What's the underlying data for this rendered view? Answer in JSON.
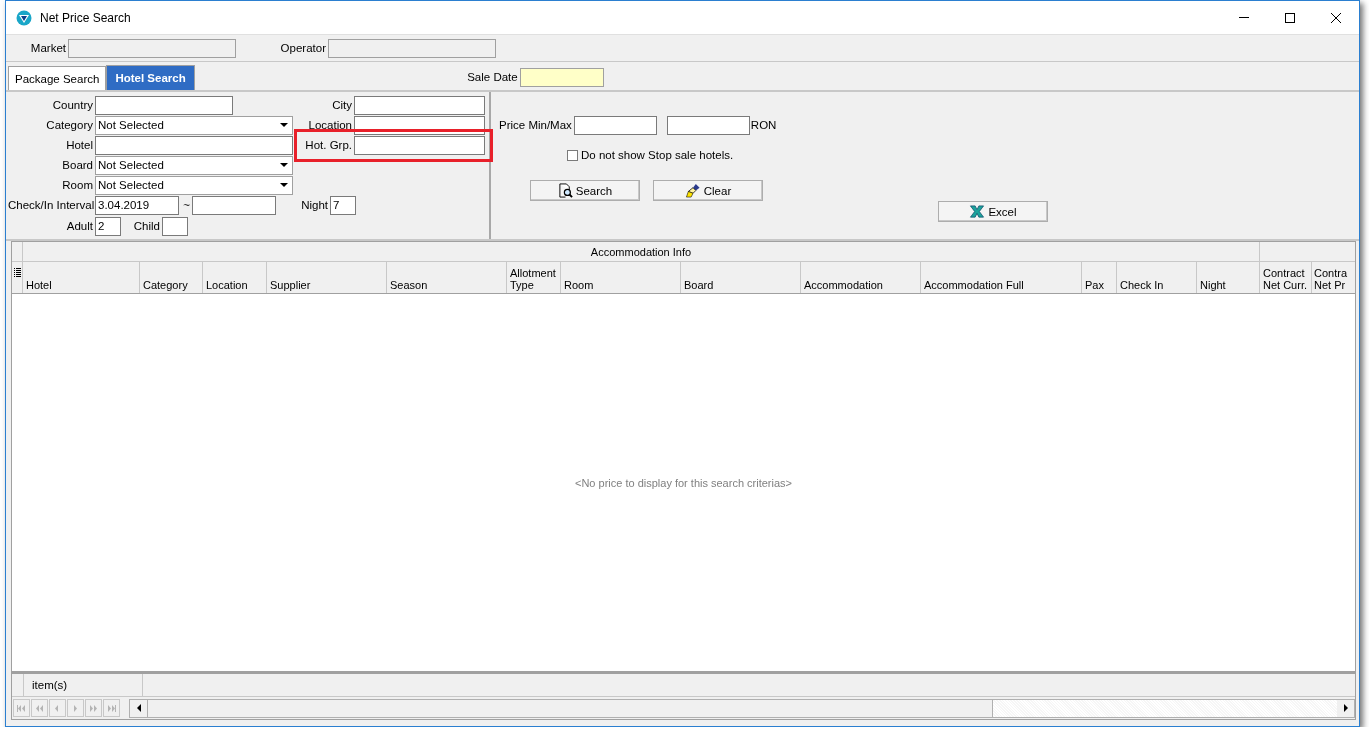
{
  "window": {
    "title": "Net Price Search"
  },
  "header": {
    "fields": [
      {
        "label": "Market",
        "disabled": true
      },
      {
        "label": "Operator",
        "disabled": true
      }
    ]
  },
  "tabs": [
    {
      "label": "Package Search",
      "selected": false
    },
    {
      "label": "Hotel Search",
      "selected": true
    }
  ],
  "sale_date": {
    "label": "Sale Date",
    "kind": "required"
  },
  "filters": [
    {
      "label": "Country",
      "kind": "text"
    },
    {
      "label": "City",
      "kind": "text"
    },
    {
      "label": "Category",
      "kind": "select",
      "value": "Not Selected"
    },
    {
      "label": "Location",
      "kind": "text"
    },
    {
      "label": "Hotel",
      "kind": "text"
    },
    {
      "label": "Hot. Grp.",
      "kind": "text",
      "highlighted": true
    },
    {
      "label": "Board",
      "kind": "select",
      "value": "Not Selected"
    },
    {
      "label": "Room",
      "kind": "select",
      "value": "Not Selected"
    },
    {
      "label": "Check/In Interval",
      "kind": "text",
      "value": "3.04.2019"
    },
    {
      "label": "~",
      "kind": "text"
    },
    {
      "label": "Night",
      "kind": "text",
      "value": "7"
    },
    {
      "label": "Adult",
      "kind": "text",
      "value": "2"
    },
    {
      "label": "Child",
      "kind": "text"
    }
  ],
  "price": {
    "label": "Price Min/Max",
    "currency": "RON"
  },
  "stop_sale": {
    "label": "Do not show Stop sale hotels.",
    "checked": false
  },
  "buttons": [
    {
      "label": "Search",
      "kind": "search"
    },
    {
      "label": "Clear",
      "kind": "clear"
    },
    {
      "label": "Excel",
      "kind": "excel"
    }
  ],
  "grid": {
    "groups": [
      {
        "label": "Accommodation Info"
      }
    ],
    "columns": [
      "Hotel",
      "Category",
      "Location",
      "Supplier",
      "Season",
      "Allotment Type",
      "Room",
      "Board",
      "Accommodation",
      "Accommodation Full",
      "Pax",
      "Check In",
      "Night",
      "Contract Net Curr.",
      "Contra Net Pr"
    ],
    "empty_message": "<No price to display for this search criterias>",
    "footer": "item(s)"
  }
}
